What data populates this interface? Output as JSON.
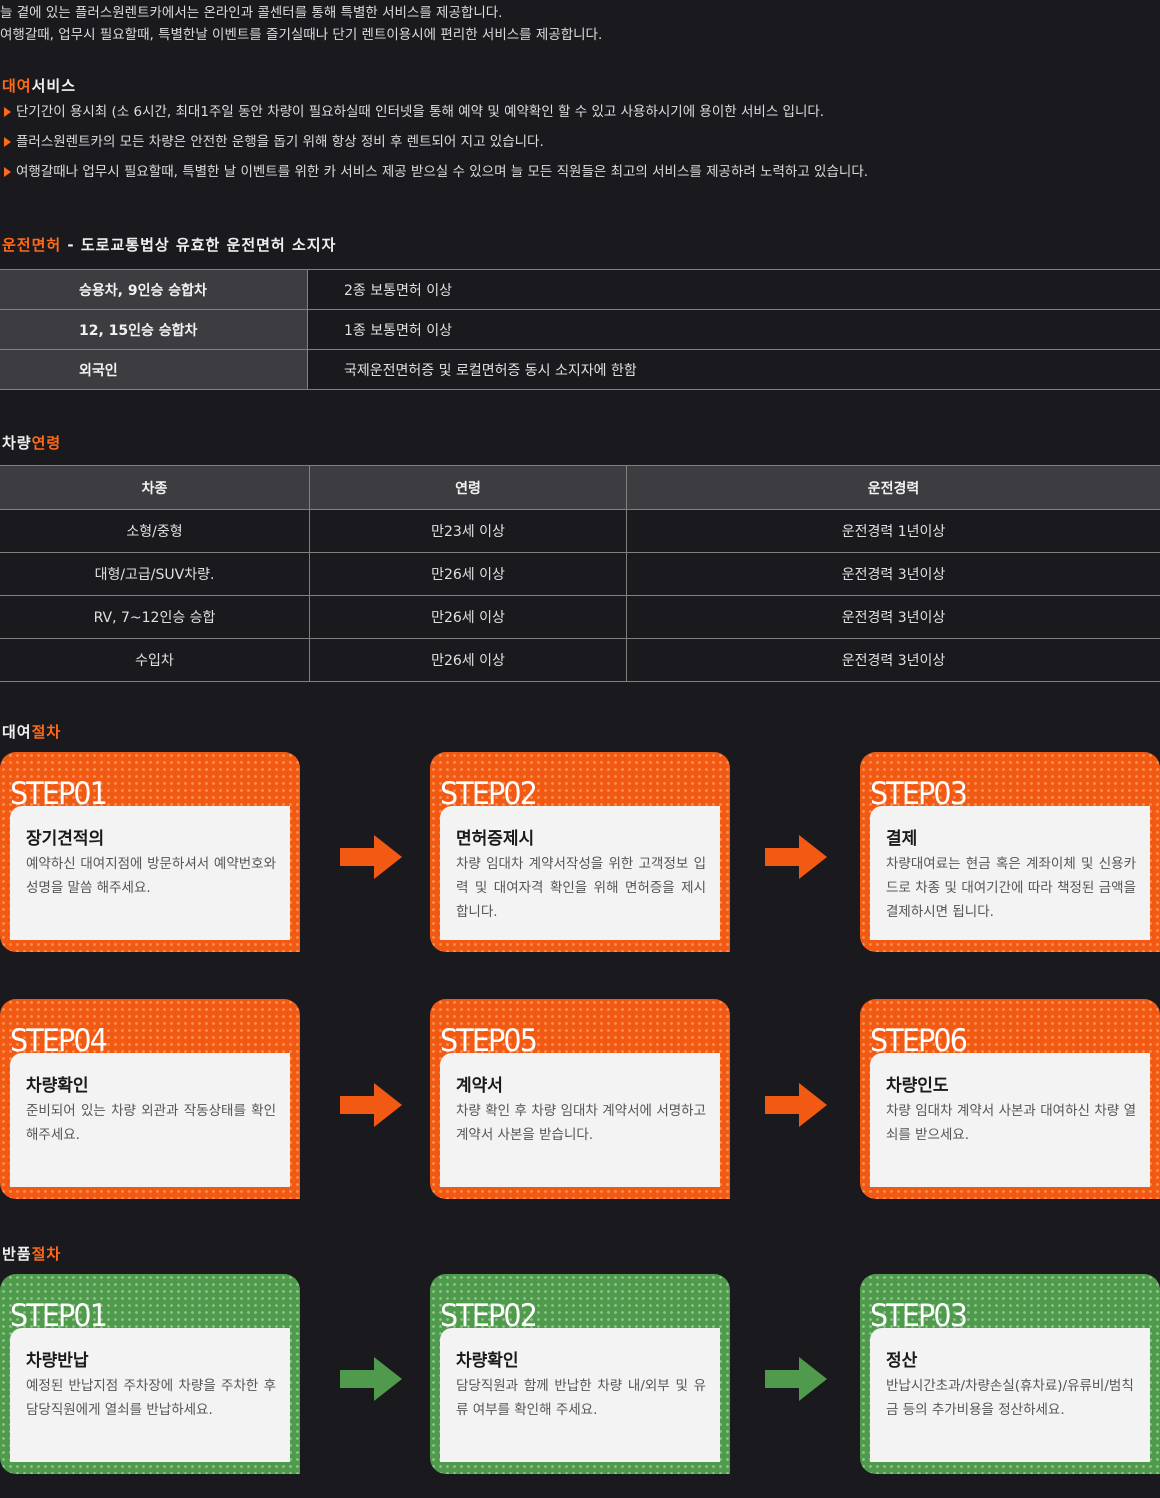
{
  "intro": {
    "line1": "늘 곁에 있는 플러스원렌트카에서는 온라인과 콜센터를 통해 특별한 서비스를 제공합니다.",
    "line2": "여행갈때, 업무시 필요할때, 특별한날 이벤트를 즐기실때나 단기 렌트이용시에 편리한 서비스를 제공합니다."
  },
  "rental_service": {
    "title_hl": "대여",
    "title_rest": "서비스",
    "items": [
      "단기간이 용시최 (소 6시간, 최대1주일 동안 차량이 필요하실때 인터넷을 통해 예약 및 예약확인 할 수 있고 사용하시기에 용이한 서비스 입니다.",
      "플러스원렌트카의 모든 차량은 안전한 운행을 돕기 위해 항상 정비 후 렌트되어 지고 있습니다.",
      "여행갈때나 업무시 필요할때, 특별한 날 이벤트를 위한 카 서비스 제공 받으실 수 있으며 늘 모든 직원들은 최고의 서비스를 제공하려 노력하고 있습니다."
    ]
  },
  "license": {
    "title_hl": "운전면허",
    "title_rest": " - 도로교통법상 유효한 운전면허 소지자",
    "rows": [
      {
        "k": "승용차, 9인승 승합차",
        "v": "2종 보통면허 이상"
      },
      {
        "k": "12, 15인승 승합차",
        "v": "1종 보통면허 이상"
      },
      {
        "k": "외국인",
        "v": "국제운전면허증 및 로컬면허증 동시 소지자에 한함"
      }
    ]
  },
  "age": {
    "title_pre": "차량",
    "title_hl": "연령",
    "headers": [
      "차종",
      "연령",
      "운전경력"
    ],
    "rows": [
      [
        "소형/중형",
        "만23세 이상",
        "운전경력 1년이상"
      ],
      [
        "대형/고급/SUV차량.",
        "만26세 이상",
        "운전경력 3년이상"
      ],
      [
        "RV, 7~12인승 승합",
        "만26세 이상",
        "운전경력 3년이상"
      ],
      [
        "수입차",
        "만26세 이상",
        "운전경력 3년이상"
      ]
    ]
  },
  "rent_process": {
    "title_pre": "대여",
    "title_hl": "절차",
    "steps": [
      {
        "step": "STEP01",
        "title": "장기견적의",
        "desc": "예약하신 대여지점에 방문하셔서 예약번호와 성명을 말씀 해주세요."
      },
      {
        "step": "STEP02",
        "title": "면허증제시",
        "desc": "차량 임대차 계약서작성을 위한 고객정보 입력 및 대여자격 확인을 위해 면허증을 제시 합니다."
      },
      {
        "step": "STEP03",
        "title": "결제",
        "desc": "차량대여료는 현금 혹은 계좌이체 및 신용카드로 차종 및 대여기간에 따라 책정된 금액을 결제하시면 됩니다."
      },
      {
        "step": "STEP04",
        "title": "차량확인",
        "desc": "준비되어 있는 차량 외관과 작동상태를 확인해주세요."
      },
      {
        "step": "STEP05",
        "title": "계약서",
        "desc": "차량 확인 후 차량 임대차 계약서에 서명하고 계약서 사본을 받습니다."
      },
      {
        "step": "STEP06",
        "title": "차량인도",
        "desc": "차량 임대차 계약서 사본과 대여하신 차량 열쇠를 받으세요."
      }
    ]
  },
  "return_process": {
    "title_pre": "반품",
    "title_hl": "절차",
    "steps": [
      {
        "step": "STEP01",
        "title": "차량반납",
        "desc": "예정된 반납지점 주차장에 차량을 주차한 후 담당직원에게 열쇠를 반납하세요."
      },
      {
        "step": "STEP02",
        "title": "차량확인",
        "desc": "담당직원과 함께 반납한 차량 내/외부 및 유류 여부를 확인해 주세요."
      },
      {
        "step": "STEP03",
        "title": "정산",
        "desc": "반납시간초과/차량손실(휴차료)/유류비/범칙금 등의 추가비용을 정산하세요."
      }
    ]
  },
  "colors": {
    "accent": "#ff6a1a",
    "card_orange": "#f25a14",
    "card_green": "#4f9a4c",
    "background": "#1a191d"
  }
}
